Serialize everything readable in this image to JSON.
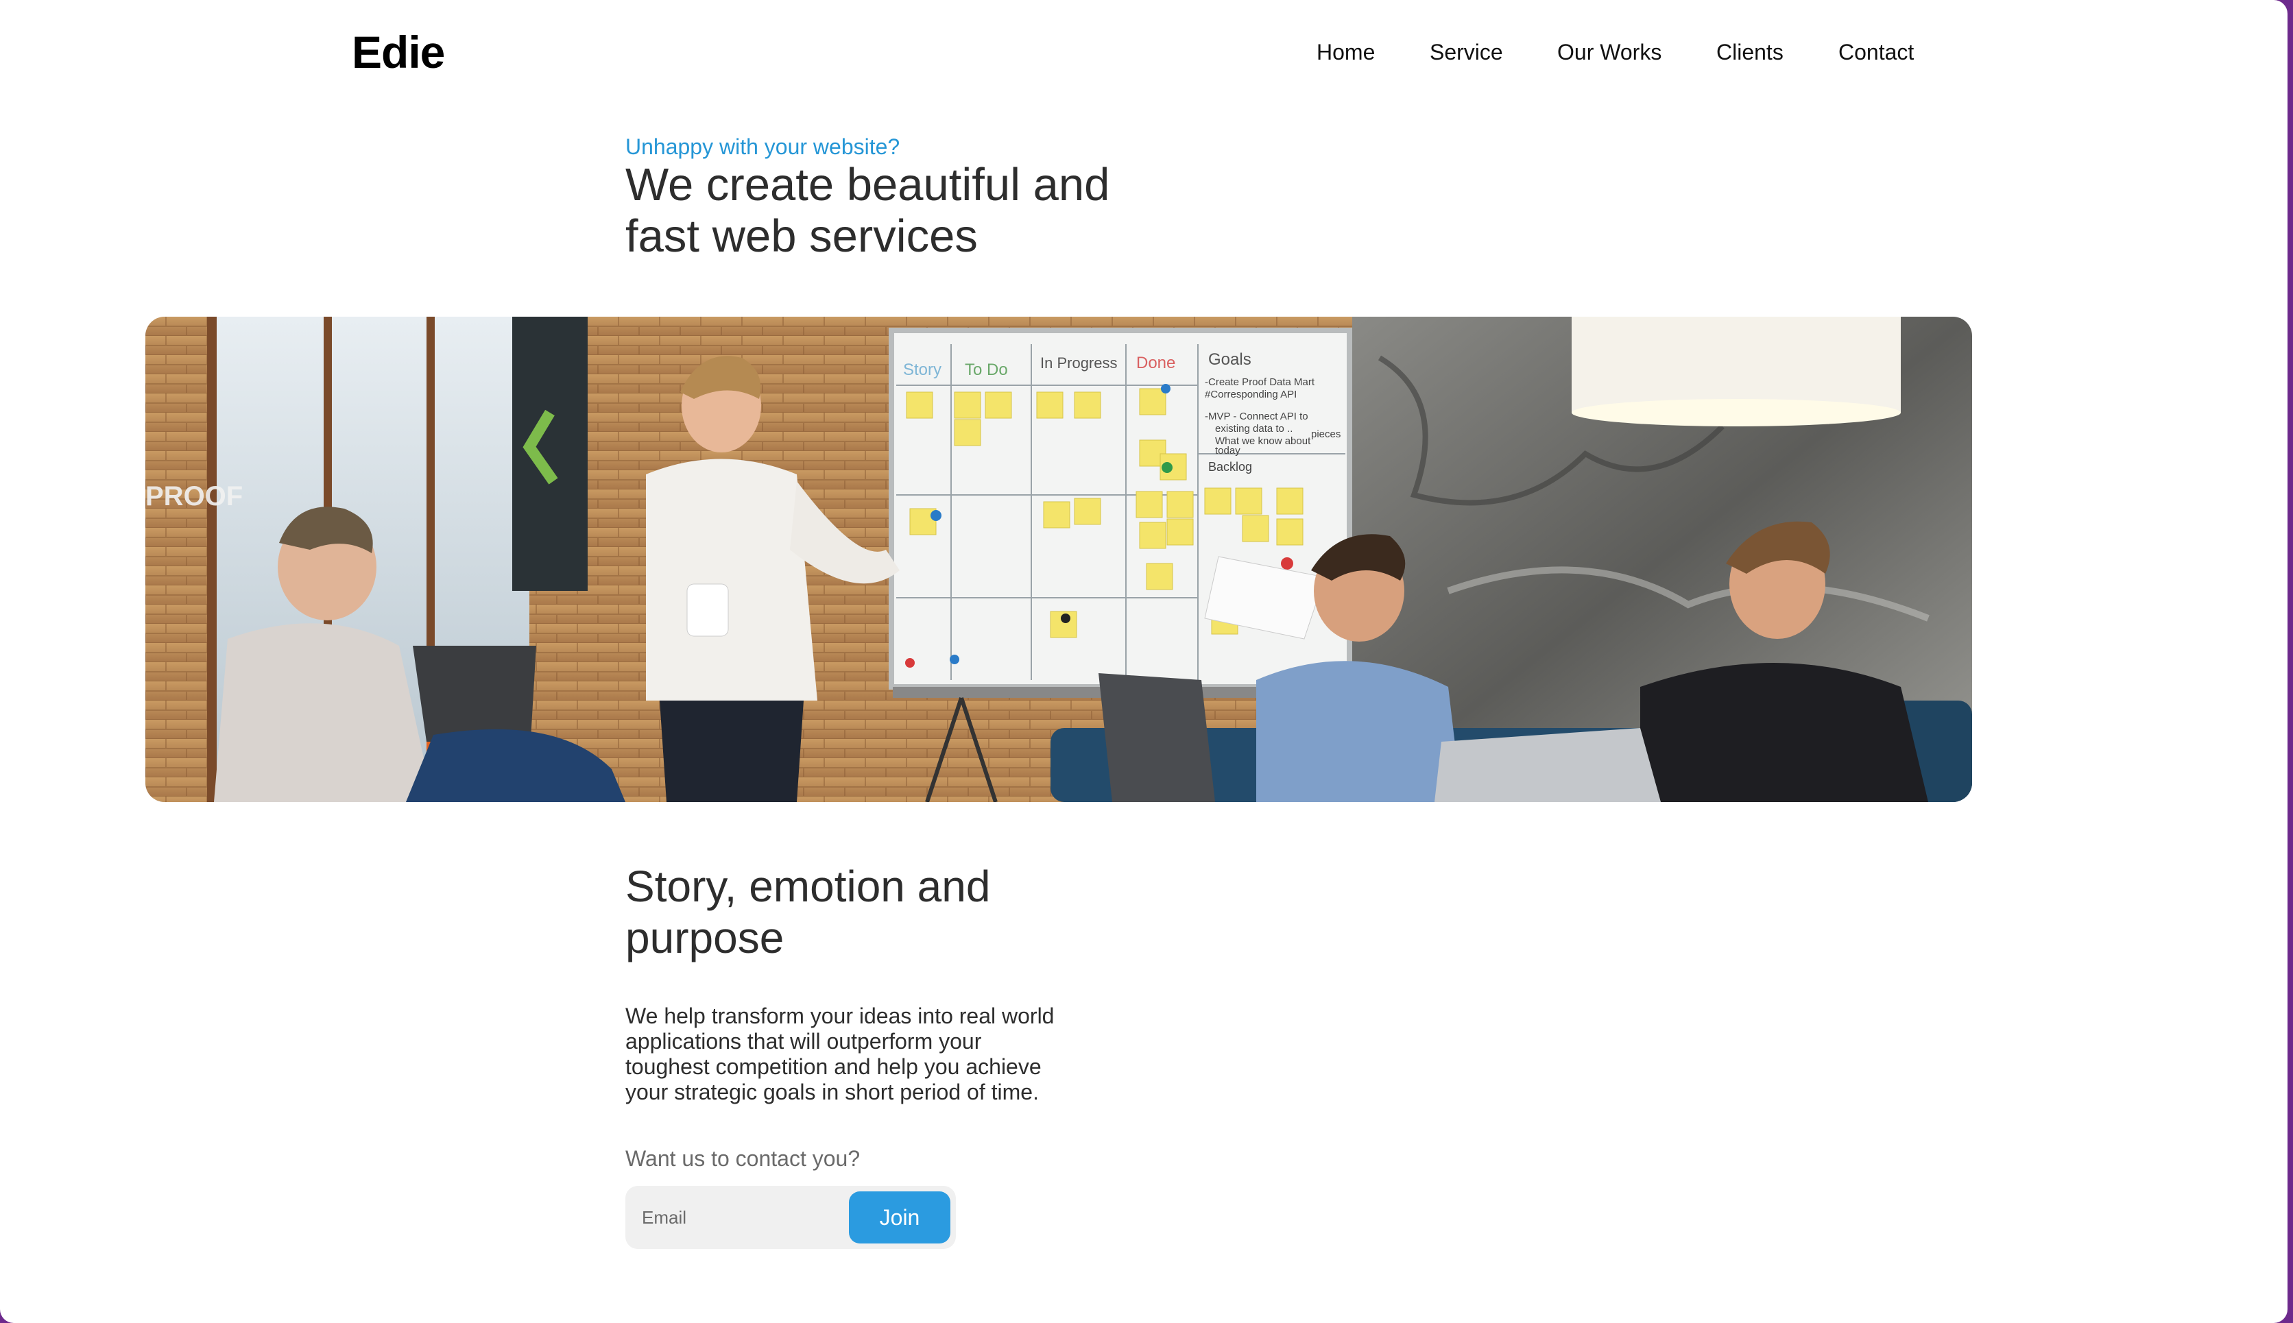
{
  "header": {
    "logo": "Edie",
    "nav": [
      {
        "label": "Home"
      },
      {
        "label": "Service"
      },
      {
        "label": "Our Works"
      },
      {
        "label": "Clients"
      },
      {
        "label": "Contact"
      }
    ]
  },
  "hero": {
    "eyebrow": "Unhappy with your website?",
    "title": "We create beautiful and fast web services"
  },
  "whiteboard": {
    "columns": [
      "Story",
      "To Do",
      "In Progress",
      "Done",
      "Goals"
    ],
    "goals_notes": [
      "-Create Proof Data Mart",
      "#Corresponding API",
      "-MVP - Connect API to",
      "existing data to ..",
      "What we know about",
      "pieces",
      "today"
    ],
    "backlog": "Backlog"
  },
  "story": {
    "title": "Story, emotion and purpose",
    "body": "We help transform your ideas into real world applications that will outperform your toughest competition and help you achieve your strategic goals in short period of time."
  },
  "signup": {
    "label": "Want us to contact you?",
    "email_placeholder": "Email",
    "join_label": "Join"
  },
  "colors": {
    "accent": "#2596d6",
    "button": "#2b9be0",
    "frame": "#6d2a8c"
  }
}
